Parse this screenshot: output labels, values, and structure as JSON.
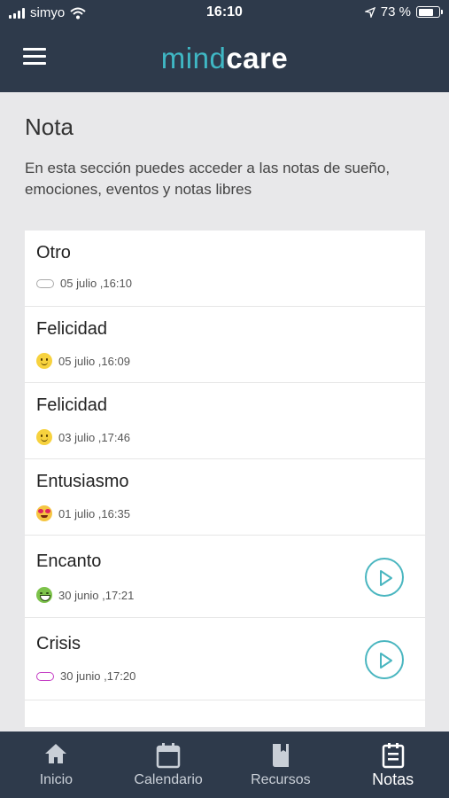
{
  "status_bar": {
    "carrier": "simyo",
    "time": "16:10",
    "battery": "73 %",
    "battery_level": 0.73
  },
  "app": {
    "logo_part1": "mind",
    "logo_part2": "care",
    "accent": "#3fb7c4",
    "header_bg": "#2e3a4b"
  },
  "page": {
    "title": "Nota",
    "description": "En esta sección puedes acceder a las notas de sueño, emociones, eventos y notas libres"
  },
  "notes": [
    {
      "title": "Otro",
      "date": "05 julio ,16:10",
      "icon": "grey-pill-icon",
      "audio": false
    },
    {
      "title": "Felicidad",
      "date": "05 julio ,16:09",
      "icon": "smiley-face-icon",
      "audio": false
    },
    {
      "title": "Felicidad",
      "date": "03 julio ,17:46",
      "icon": "smiley-face-icon",
      "audio": false
    },
    {
      "title": "Entusiasmo",
      "date": "01 julio ,16:35",
      "icon": "heart-eyes-face-icon",
      "audio": false
    },
    {
      "title": "Encanto",
      "date": "30 junio ,17:21",
      "icon": "grinning-face-icon",
      "audio": true
    },
    {
      "title": "Crisis",
      "date": "30 junio ,17:20",
      "icon": "magenta-pill-icon",
      "audio": true
    }
  ],
  "tabs": [
    {
      "label": "Inicio",
      "icon": "home-icon",
      "active": false
    },
    {
      "label": "Calendario",
      "icon": "calendar-icon",
      "active": false
    },
    {
      "label": "Recursos",
      "icon": "book-icon",
      "active": false
    },
    {
      "label": "Notas",
      "icon": "notes-icon",
      "active": true
    }
  ]
}
